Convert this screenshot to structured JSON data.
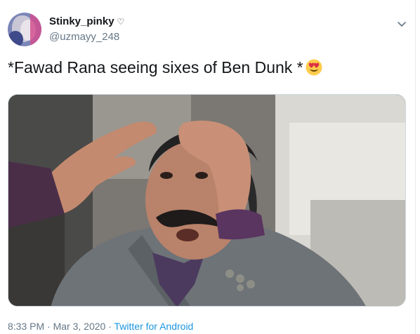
{
  "user": {
    "display_name": "Stinky_pinky",
    "badge_icon": "heart-outline-icon",
    "handle": "@uzmayy_248"
  },
  "tweet": {
    "text": "*Fawad Rana seeing sixes of Ben Dunk *",
    "trailing_emoji": "heart-eyes-emoji-icon"
  },
  "media": {
    "type": "photo",
    "subject": "man saluting with both hands shading eyes"
  },
  "meta": {
    "time": "8:33 PM",
    "separator": "·",
    "date": "Mar 3, 2020",
    "source": "Twitter for Android"
  },
  "colors": {
    "text_primary": "#14171a",
    "text_secondary": "#657786",
    "link": "#1b95e0",
    "border": "#e6ecf0"
  }
}
